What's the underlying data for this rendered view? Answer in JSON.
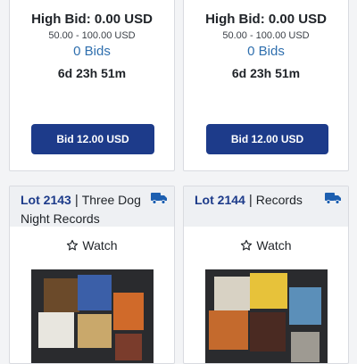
{
  "cards_top": [
    {
      "high_bid": "High Bid: 0.00 USD",
      "range": "50.00 - 100.00 USD",
      "bids": "0 Bids",
      "time_left": "6d 23h 51m",
      "bid_button": "Bid 12.00 USD"
    },
    {
      "high_bid": "High Bid: 0.00 USD",
      "range": "50.00 - 100.00 USD",
      "bids": "0 Bids",
      "time_left": "6d 23h 51m",
      "bid_button": "Bid 12.00 USD"
    }
  ],
  "cards_bottom": [
    {
      "lot": "Lot 2143",
      "sep": "|",
      "title_line1": "Three Dog",
      "title_line2": "Night Records",
      "watch": "Watch",
      "shipping_icon": "truck-icon",
      "image_label": "lot-photo"
    },
    {
      "lot": "Lot 2144",
      "sep": "|",
      "title_line1": "Records",
      "watch": "Watch",
      "shipping_icon": "truck-icon",
      "image_label": "lot-photo"
    }
  ],
  "colors": {
    "accent": "#1d3b8a",
    "link": "#2f6fae",
    "background": "#f3f4f6"
  }
}
